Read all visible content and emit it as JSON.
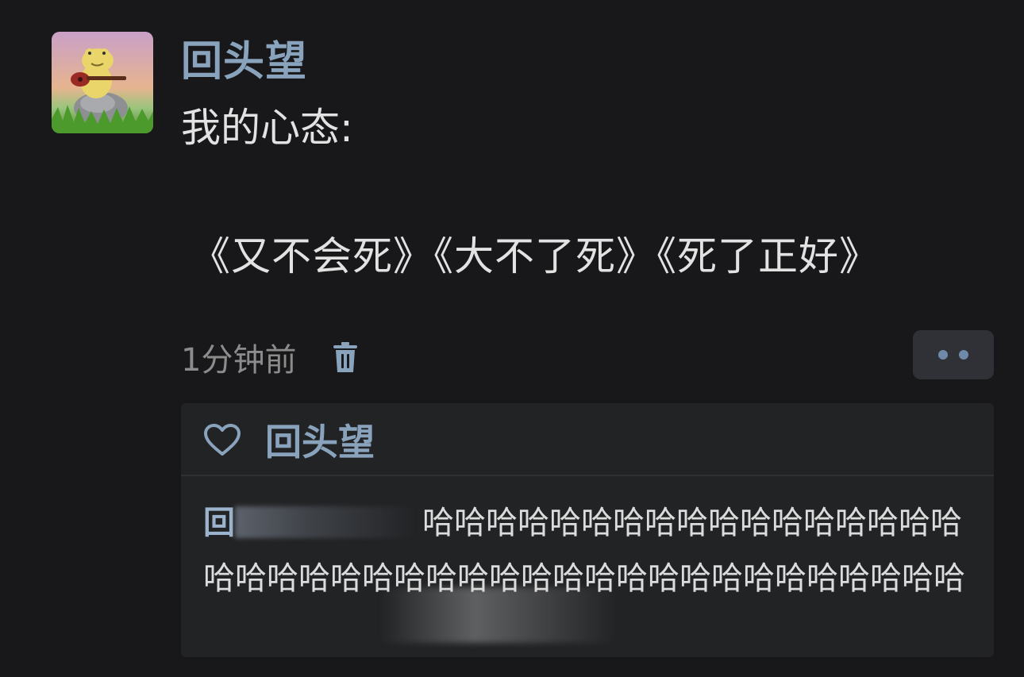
{
  "post": {
    "author": "回头望",
    "line1": "我的心态:",
    "line2": "《又不会死》《大不了死》《死了正好》",
    "timestamp": "1分钟前"
  },
  "icons": {
    "delete": "trash-icon",
    "more": "more-dots-icon",
    "like": "heart-icon"
  },
  "reactions": {
    "liked_by": "回头望"
  },
  "comment": {
    "author": "回",
    "text": "哈哈哈哈哈哈哈哈哈哈哈哈哈哈哈哈哈哈哈哈哈哈哈哈哈哈哈哈哈哈哈哈哈哈哈哈哈哈哈哈哈"
  },
  "colors": {
    "background": "#18181a",
    "accent": "#8aa3bd",
    "panel": "#222325"
  }
}
